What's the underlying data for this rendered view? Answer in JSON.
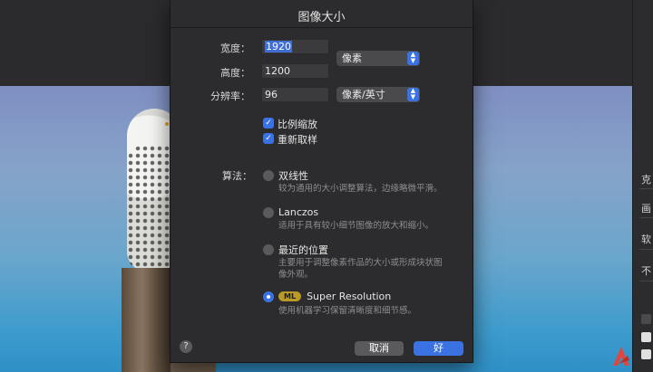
{
  "dialog": {
    "title": "图像大小",
    "width_label": "宽度：",
    "width_value": "1920",
    "height_label": "高度：",
    "height_value": "1200",
    "resolution_label": "分辨率：",
    "resolution_value": "96",
    "size_unit": "像素",
    "resolution_unit": "像素/英寸",
    "constrain_label": "比例缩放",
    "constrain_checked": true,
    "resample_label": "重新取样",
    "resample_checked": true,
    "algorithm_label": "算法：",
    "options": [
      {
        "title": "双线性",
        "desc": "较为通用的大小调整算法，边缘略微平滑。",
        "selected": false
      },
      {
        "title": "Lanczos",
        "desc": "适用于具有较小细节图像的放大和缩小。",
        "selected": false
      },
      {
        "title": "最近的位置",
        "desc_line1": "主要用于调整像素作品的大小或形成块状图",
        "desc_line2": "像外观。",
        "selected": false
      },
      {
        "badge": "ML",
        "title": "Super Resolution",
        "desc": "使用机器学习保留清晰度和细节感。",
        "selected": true
      }
    ],
    "help": "?",
    "cancel": "取消",
    "ok": "好"
  },
  "right_panel": {
    "labels": [
      "克",
      "画",
      "软",
      "不"
    ]
  },
  "colors": {
    "accent": "#3b72e3",
    "dialog_bg": "#2c2c2e"
  },
  "icons": {
    "help": "help-icon",
    "checkmark": "checkmark-icon",
    "stepper": "stepper-icon",
    "logo": "app-logo-icon"
  }
}
